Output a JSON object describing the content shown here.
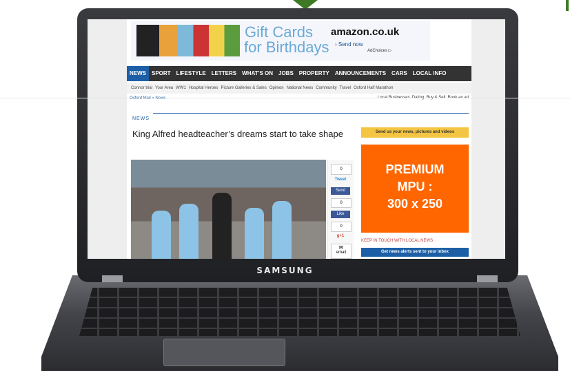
{
  "laptop": {
    "brand": "SAMSUNG"
  },
  "ad": {
    "headline_1": "Gift Cards",
    "headline_2": "for Birthdays",
    "advertiser": "amazon.co.uk",
    "cta": "› Send now",
    "choices": "AdChoices ▷"
  },
  "nav": {
    "items": [
      "NEWS",
      "SPORT",
      "LIFESTYLE",
      "LETTERS",
      "WHAT'S ON",
      "JOBS",
      "PROPERTY",
      "ANNOUNCEMENTS",
      "CARS",
      "LOCAL INFO"
    ]
  },
  "subnav": {
    "items": [
      "Connor trial",
      "Your Area",
      "WW1",
      "Hospital Heroes",
      "Picture Galleries & Sales",
      "Opinion",
      "National News",
      "Community",
      "Travel",
      "Oxford Half Marathon"
    ]
  },
  "breadcrumb": "Oxford Mail » News",
  "right_links": [
    "Local Businesses",
    "Dating",
    "Buy & Sell",
    "Book an ad"
  ],
  "section_label": "NEWS",
  "article": {
    "title": "King Alfred headteacher’s dreams start to take shape"
  },
  "share": {
    "count_top": "0",
    "tweet": "Tweet",
    "send": "Send",
    "like_count": "0",
    "like": "Like",
    "count_mid": "0",
    "gplus": "g+1",
    "email": "email"
  },
  "sidebar": {
    "send_news": "Send us your news, pictures and videos",
    "mpu_line1": "PREMIUM",
    "mpu_line2": "MPU :",
    "mpu_line3": "300 x 250",
    "keep_in_touch": "KEEP IN TOUCH WITH LOCAL NEWS",
    "alerts": "Get news alerts sent to your inbox"
  }
}
